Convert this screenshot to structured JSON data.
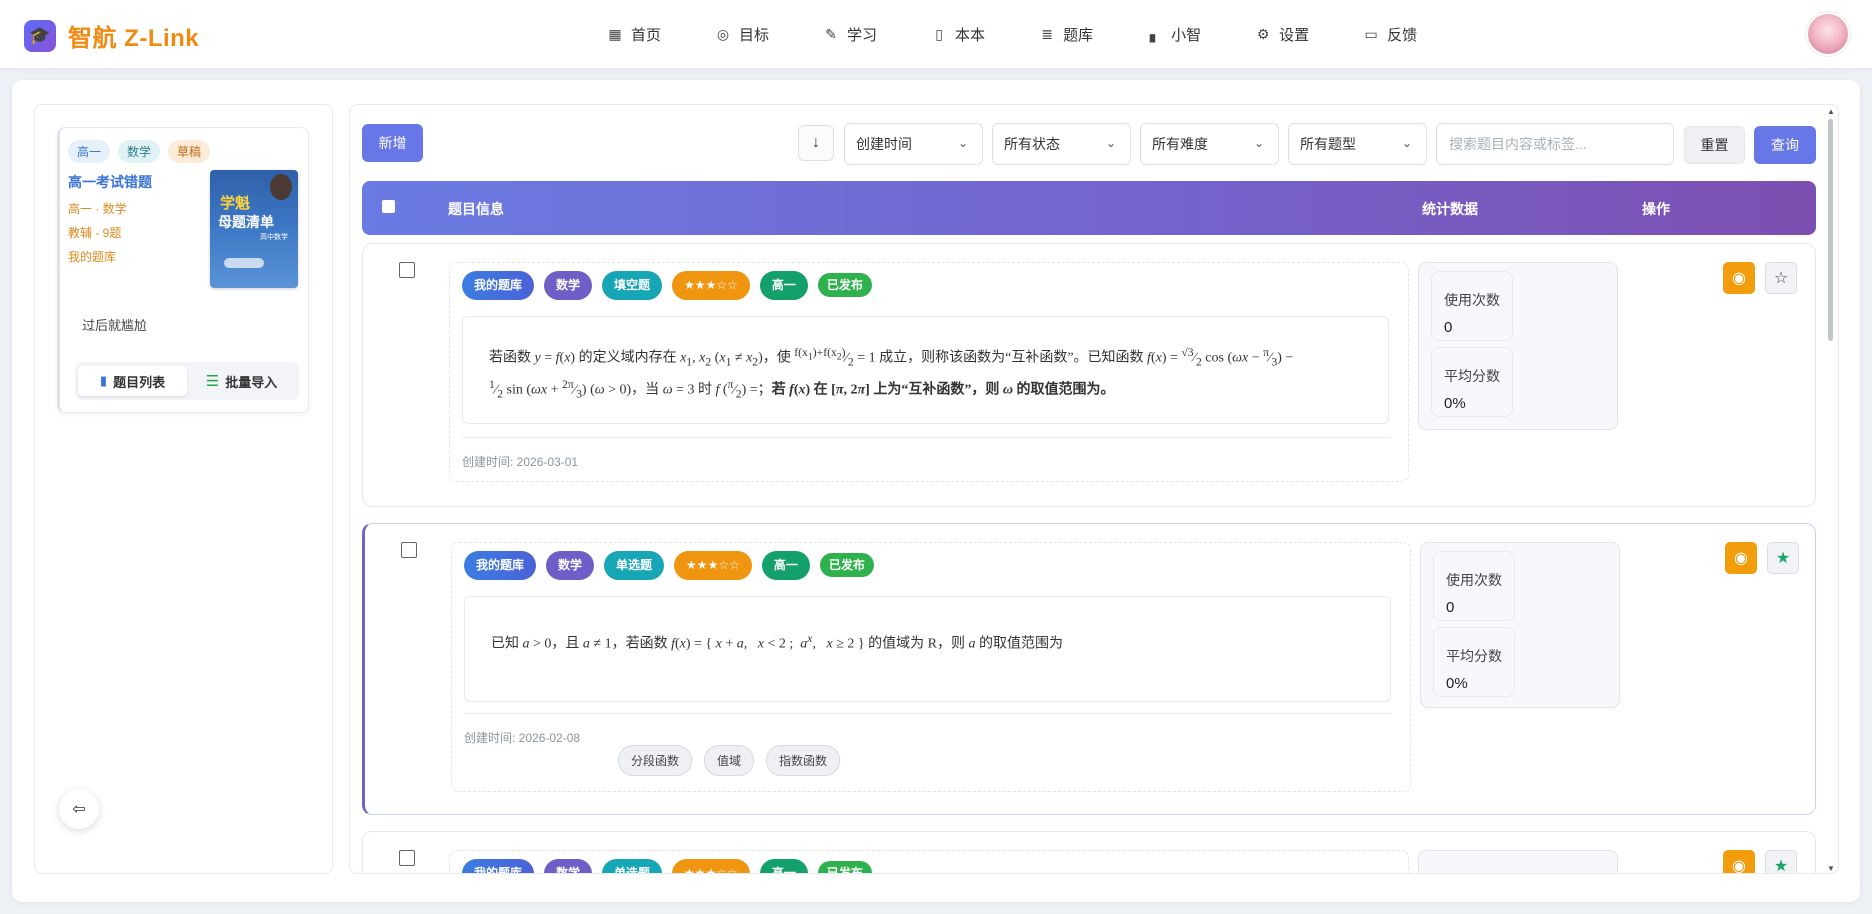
{
  "app": {
    "brand": "智航 Z-Link"
  },
  "nav": [
    {
      "icon": "grid-icon",
      "glyph": "▦",
      "label": "首页"
    },
    {
      "icon": "target-icon",
      "glyph": "◎",
      "label": "目标"
    },
    {
      "icon": "study-icon",
      "glyph": "✎",
      "label": "学习"
    },
    {
      "icon": "book-icon",
      "glyph": "▯",
      "label": "本本"
    },
    {
      "icon": "list-icon",
      "glyph": "≣",
      "label": "题库"
    },
    {
      "icon": "chart-icon",
      "glyph": "▖",
      "label": "小智"
    },
    {
      "icon": "gear-icon",
      "glyph": "⚙",
      "label": "设置"
    },
    {
      "icon": "chat-icon",
      "glyph": "▭",
      "label": "反馈"
    }
  ],
  "book": {
    "tags": [
      "高一",
      "数学",
      "草稿"
    ],
    "title": "高一考试错题",
    "meta": [
      "高一 · 数学",
      "教辅 - 9题",
      "我的题库"
    ],
    "cover_line1": "学魁",
    "cover_line2": "母题清单",
    "cover_line3": "高中数学",
    "note": "过后就尴尬",
    "tab_list": "题目列表",
    "tab_import": "批量导入"
  },
  "toolbar": {
    "add": "新增",
    "sort_glyph": "↓",
    "selects": [
      "创建时间",
      "所有状态",
      "所有难度",
      "所有题型"
    ],
    "search_placeholder": "搜索题目内容或标签...",
    "reset": "重置",
    "query": "查询"
  },
  "table_header": {
    "info": "题目信息",
    "stats": "统计数据",
    "ops": "操作"
  },
  "questions": [
    {
      "tags": [
        "我的题库",
        "数学",
        "填空题",
        "★★★☆☆",
        "高一",
        "已发布"
      ],
      "created": "创建时间: 2026-03-01",
      "usage_label": "使用次数",
      "usage": "0",
      "avg_label": "平均分数",
      "avg": "0%",
      "favorited": false
    },
    {
      "tags": [
        "我的题库",
        "数学",
        "单选题",
        "★★★☆☆",
        "高一",
        "已发布"
      ],
      "created": "创建时间: 2026-02-08",
      "knowledge": [
        "分段函数",
        "值域",
        "指数函数"
      ],
      "usage_label": "使用次数",
      "usage": "0",
      "avg_label": "平均分数",
      "avg": "0%",
      "favorited": true
    },
    {
      "tags": [
        "我的题库",
        "数学",
        "单选题",
        "★★★☆☆",
        "高一",
        "已发布"
      ],
      "favorited": true
    }
  ],
  "colors": {
    "accent": "#6777e8",
    "brand": "#f08a12",
    "eye": "#f29d0c",
    "fav": "#1aa66a"
  }
}
